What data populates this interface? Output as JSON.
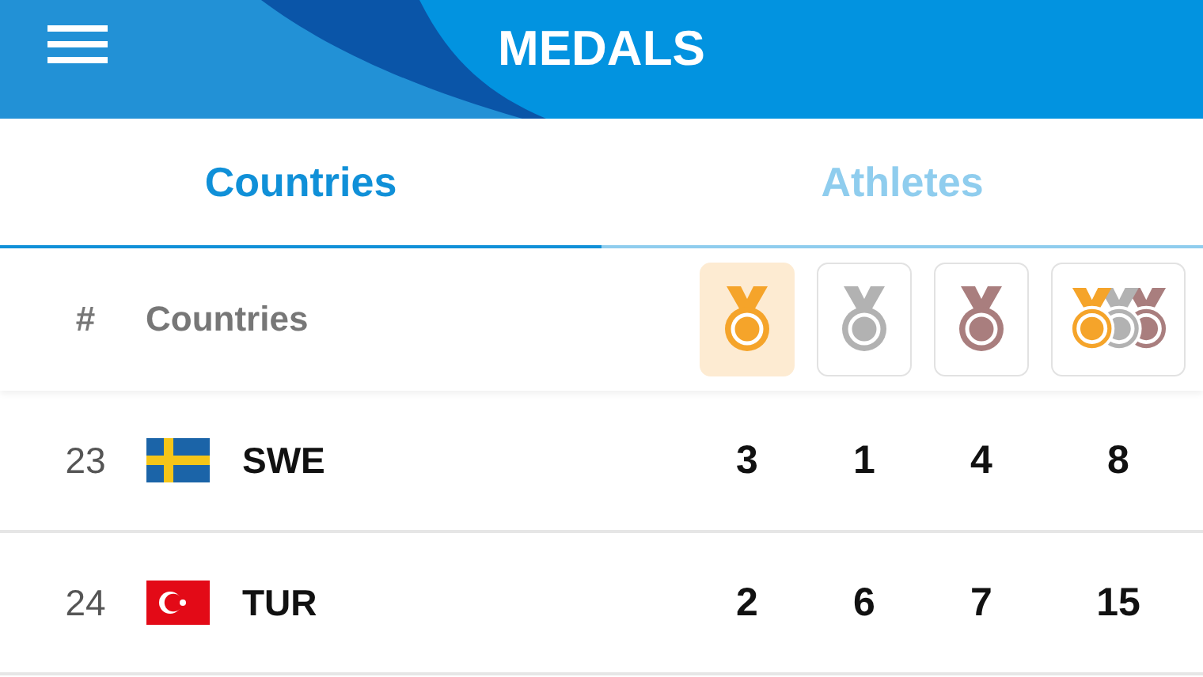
{
  "header": {
    "title": "MEDALS"
  },
  "tabs": [
    {
      "label": "Countries",
      "selected": true
    },
    {
      "label": "Athletes",
      "selected": false
    }
  ],
  "table": {
    "rank_heading": "#",
    "country_heading": "Countries",
    "medal_columns": [
      {
        "kind": "gold",
        "selected": true
      },
      {
        "kind": "silver",
        "selected": false
      },
      {
        "kind": "bronze",
        "selected": false
      },
      {
        "kind": "total",
        "selected": false
      }
    ],
    "rows": [
      {
        "rank": "23",
        "kind": "sweden",
        "code": "SWE",
        "gold": "3",
        "silver": "1",
        "bronze": "4",
        "total": "8"
      },
      {
        "rank": "24",
        "kind": "turkey",
        "code": "TUR",
        "gold": "2",
        "silver": "6",
        "bronze": "7",
        "total": "15"
      }
    ]
  }
}
